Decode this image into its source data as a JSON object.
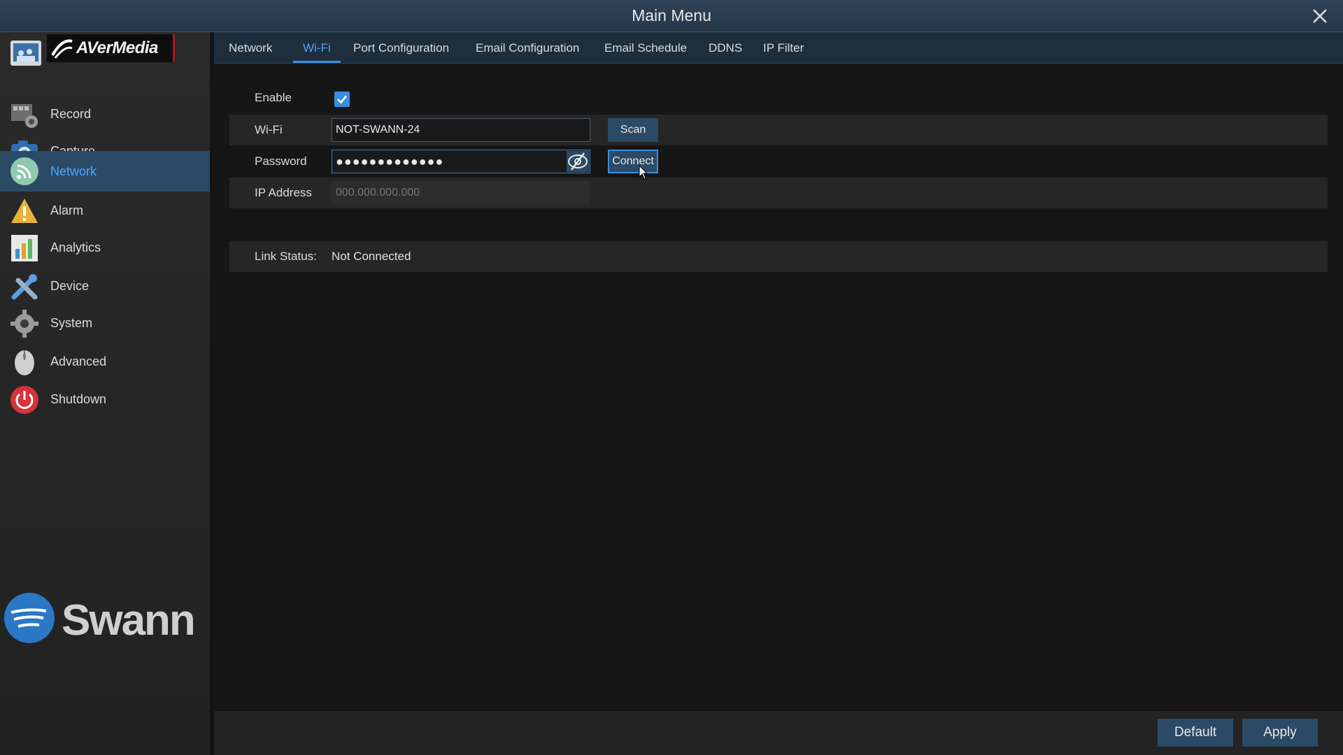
{
  "window": {
    "title": "Main Menu",
    "close_icon": "close-icon"
  },
  "brand": {
    "top_logo": "AVerMedia",
    "bottom_logo": "Swann"
  },
  "sidebar": {
    "items": [
      {
        "label": "Record",
        "icon": "record-icon"
      },
      {
        "label": "Capture",
        "icon": "camera-icon"
      },
      {
        "label": "Network",
        "icon": "network-icon",
        "active": true
      },
      {
        "label": "Alarm",
        "icon": "alarm-icon"
      },
      {
        "label": "Analytics",
        "icon": "analytics-icon"
      },
      {
        "label": "Device",
        "icon": "device-icon"
      },
      {
        "label": "System",
        "icon": "gear-icon"
      },
      {
        "label": "Advanced",
        "icon": "mouse-icon"
      },
      {
        "label": "Shutdown",
        "icon": "power-icon"
      }
    ]
  },
  "tabs": [
    {
      "label": "Network"
    },
    {
      "label": "Wi-Fi",
      "active": true
    },
    {
      "label": "Port Configuration"
    },
    {
      "label": "Email Configuration"
    },
    {
      "label": "Email Schedule"
    },
    {
      "label": "DDNS"
    },
    {
      "label": "IP Filter"
    }
  ],
  "wifi": {
    "enable_label": "Enable",
    "enabled": true,
    "wifi_label": "Wi-Fi",
    "wifi_value": "NOT-SWANN-24",
    "scan_label": "Scan",
    "password_label": "Password",
    "password_value": "●●●●●●●●●●●●●",
    "connect_label": "Connect",
    "ip_label": "IP Address",
    "ip_placeholder": "000.000.000.000",
    "link_status_label": "Link Status:",
    "link_status_value": "Not Connected"
  },
  "footer": {
    "default_label": "Default",
    "apply_label": "Apply"
  },
  "colors": {
    "accent": "#4da6ff",
    "active_bg": "#2b4a66",
    "title_bg": "#2f4256"
  }
}
